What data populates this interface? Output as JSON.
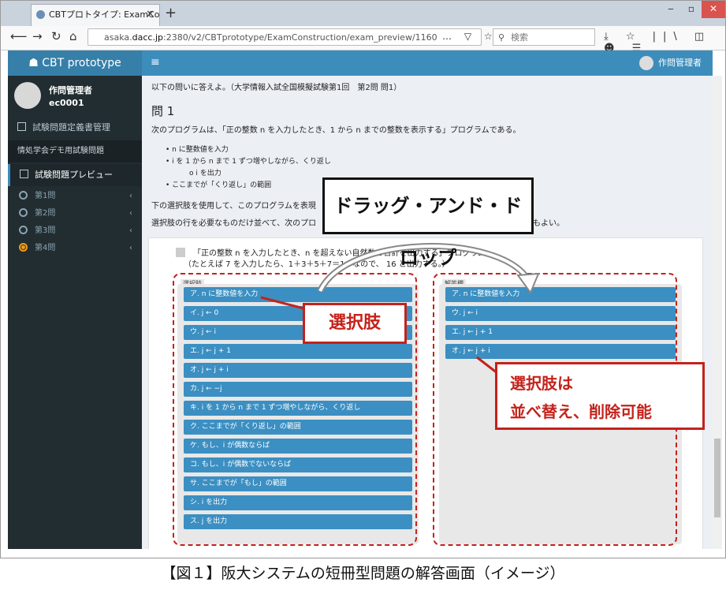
{
  "browser": {
    "tab_title": "CBTプロトタイプ: ExamConstru",
    "tab_close": "✕",
    "new_tab": "+",
    "url_prefix": "asaka.",
    "url_host": "dacc.jp",
    "url_rest": ":2380/v2/CBTprototype/ExamConstruction/exam_preview/1160",
    "url_icons": "… ▽ ☆",
    "search_placeholder": "検索",
    "tools": "⤓ ☆ ||\\ ◫ ☻ ☰",
    "win_min": "‒",
    "win_max": "▫",
    "win_close": "✕"
  },
  "app": {
    "brand": "☗ CBT prototype",
    "hamburger": "≡",
    "top_user": "作問管理者"
  },
  "sidebar": {
    "user_name": "作問管理者",
    "user_id": "ec0001",
    "item_def": "試験問題定義書管理",
    "section_header": "情処学会デモ用試験問題",
    "item_preview": "試験問題プレビュー",
    "subs": [
      "第1問",
      "第2問",
      "第3問",
      "第4問"
    ],
    "chev": "‹"
  },
  "content": {
    "intro": "以下の問いに答えよ。（大学情報入試全国模擬試験第1回　第2問 問1）",
    "q_title": "問 1",
    "q_desc": "次のプログラムは、「正の整数 n を入力したとき、1 から n までの整数を表示する」プログラムである。",
    "bullets": [
      "• n に整数値を入力",
      "• i を 1 から n まで 1 ずつ増やしながら、くり返し",
      "o i を出力",
      "• ここまでが「くり返し」の範囲"
    ],
    "line_a": "下の選択肢を使用して、このプログラムを表現",
    "line_b": "選択肢の行を必要なものだけ並べて、次のプロ",
    "line_b_tail": "もよい。",
    "panel_text_1": "「正の整数 n を入力したとき、n を超えない自然数の合計を出力する」プログラム",
    "panel_text_2": "（たとえば 7 を入力したら、1＋3＋5＋7＝16 なので、 16 と出力する。）",
    "left_label": "選択肢",
    "right_label": "解答欄",
    "choices": [
      "ア. n に整数値を入力",
      "イ. j ← 0",
      "ウ. j ← i",
      "エ. j ← j + 1",
      "オ. j ← j + i",
      "カ. j ← −j",
      "キ. i を 1 から n まで 1 ずつ増やしながら、くり返し",
      "ク. ここまでが「くり返し」の範囲",
      "ケ. もし、i が偶数ならば",
      "コ. もし、i が偶数でないならば",
      "サ. ここまでが「もし」の範囲",
      "シ. i を出力",
      "ス. j を出力"
    ],
    "answers": [
      "ア. n に整数値を入力",
      "ウ. j ← i",
      "エ. j ← j + 1",
      "オ. j ← j + i"
    ]
  },
  "annotations": {
    "dnd": "ドラッグ・アンド・ドロップ",
    "choices": "選択肢",
    "reorder_line1": "選択肢は",
    "reorder_line2": "並べ替え、削除可能"
  },
  "caption": "【図１】阪大システムの短冊型問題の解答画面（イメージ）"
}
